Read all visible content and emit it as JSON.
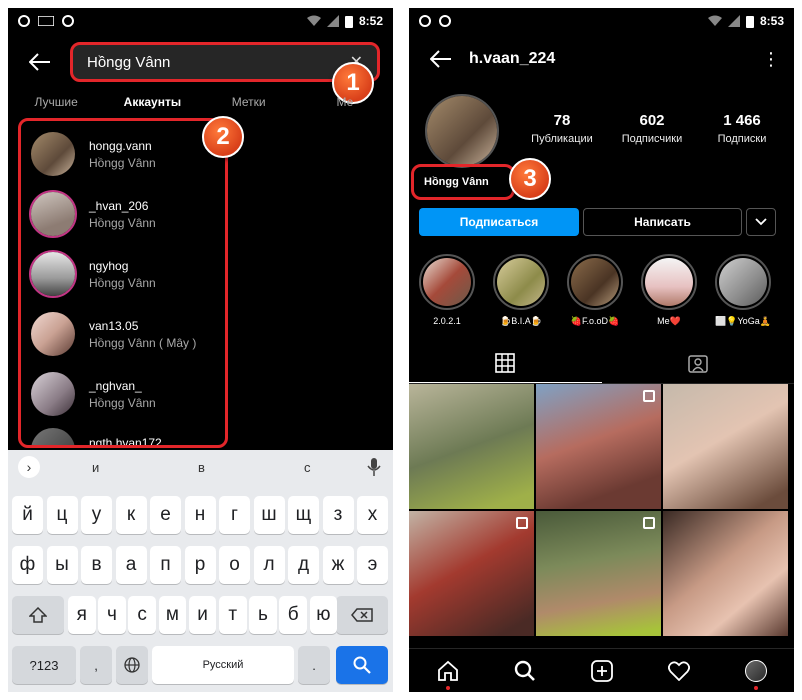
{
  "colors": {
    "accent": "#0095f6",
    "annotation": "#e3262a",
    "story_ring": "#c13584"
  },
  "left": {
    "status": {
      "time": "8:52"
    },
    "search": {
      "query": "Hồngg Vânn"
    },
    "tabs": [
      "Лучшие",
      "Аккаунты",
      "Метки",
      "Ме"
    ],
    "accounts": [
      {
        "username": "hongg.vann",
        "fullname": "Hồngg Vânn"
      },
      {
        "username": "_hvan_206",
        "fullname": "Hồngg Vânn"
      },
      {
        "username": "ngyhog",
        "fullname": "Hồngg Vânn"
      },
      {
        "username": "van13.05",
        "fullname": "Hồngg Vânn ( Mây )"
      },
      {
        "username": "_nghvan_",
        "fullname": "Hồngg Vânn"
      },
      {
        "username": "ngth.hvan172",
        "fullname": ""
      }
    ],
    "keyboard": {
      "suggestions": [
        "и",
        "в",
        "с"
      ],
      "row1": [
        "й",
        "ц",
        "у",
        "к",
        "е",
        "н",
        "г",
        "ш",
        "щ",
        "з",
        "х"
      ],
      "row2": [
        "ф",
        "ы",
        "в",
        "а",
        "п",
        "р",
        "о",
        "л",
        "д",
        "ж",
        "э"
      ],
      "row3": [
        "я",
        "ч",
        "с",
        "м",
        "и",
        "т",
        "ь",
        "б",
        "ю"
      ],
      "numbers_key": "?123",
      "comma_key": ",",
      "space_label": "Русский",
      "period_key": "."
    }
  },
  "right": {
    "status": {
      "time": "8:53"
    },
    "username": "h.vaan_224",
    "stats": [
      {
        "value": "78",
        "label": "Публикации"
      },
      {
        "value": "602",
        "label": "Подписчики"
      },
      {
        "value": "1 466",
        "label": "Подписки"
      }
    ],
    "display_name": "Hồngg Vânn",
    "follow_label": "Подписаться",
    "message_label": "Написать",
    "highlights": [
      "2.0.2.1",
      "🍺B.I.A🍺",
      "🍓F.o.oD🍓",
      "Me❤️",
      "⬜️💡YoGa🧘"
    ]
  },
  "callouts": [
    "1",
    "2",
    "3"
  ]
}
